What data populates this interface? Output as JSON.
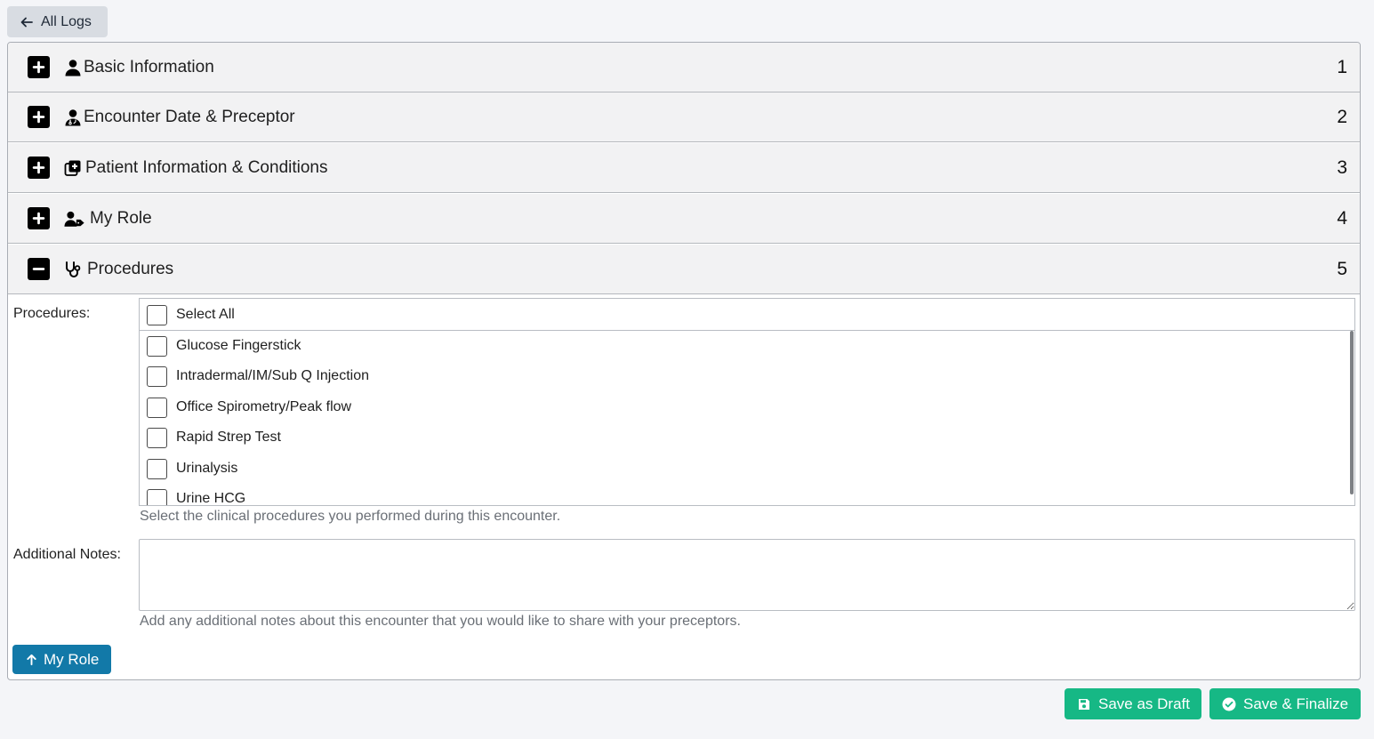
{
  "nav": {
    "back_label": "All Logs"
  },
  "sections": [
    {
      "title": "Basic Information",
      "number": "1",
      "icon": "user-icon",
      "expanded": false
    },
    {
      "title": "Encounter Date & Preceptor",
      "number": "2",
      "icon": "user-doctor-icon",
      "expanded": false
    },
    {
      "title": "Patient Information & Conditions",
      "number": "3",
      "icon": "notes-medical-icon",
      "expanded": false
    },
    {
      "title": "My Role",
      "number": "4",
      "icon": "user-tag-icon",
      "expanded": false
    },
    {
      "title": "Procedures",
      "number": "5",
      "icon": "stethoscope-icon",
      "expanded": true
    }
  ],
  "procedures": {
    "label": "Procedures:",
    "select_all": "Select All",
    "options": [
      "Glucose Fingerstick",
      "Intradermal/IM/Sub Q Injection",
      "Office Spirometry/Peak flow",
      "Rapid Strep Test",
      "Urinalysis",
      "Urine HCG"
    ],
    "help": "Select the clinical procedures you performed during this encounter."
  },
  "notes": {
    "label": "Additional Notes:",
    "value": "",
    "help": "Add any additional notes about this encounter that you would like to share with your preceptors."
  },
  "actions": {
    "previous_label": "My Role",
    "draft_label": "Save as Draft",
    "finalize_label": "Save & Finalize"
  },
  "colors": {
    "primary": "#1279a8",
    "success": "#16b885",
    "header_bg": "#f2f2f3",
    "page_bg": "#f4f5f8"
  }
}
